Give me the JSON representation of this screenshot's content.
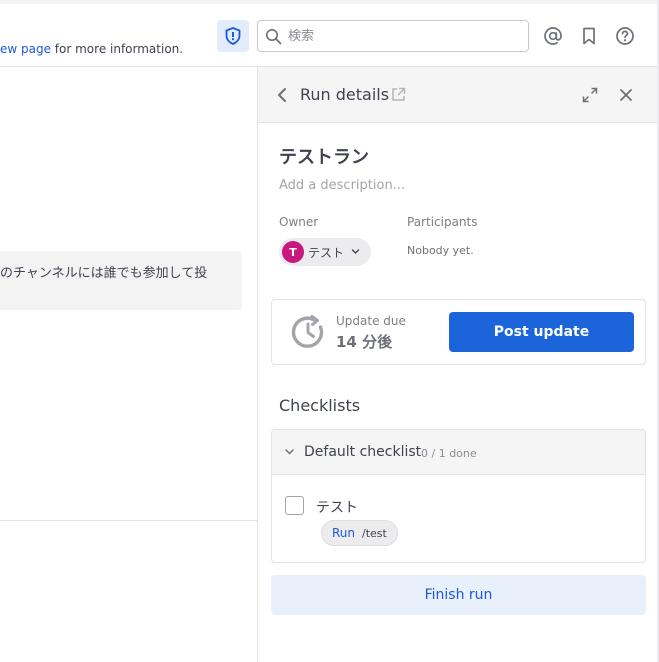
{
  "header": {
    "info_link": "ew page",
    "info_suffix": " for more information.",
    "search_placeholder": "検索",
    "icons": [
      "shield-icon",
      "search-icon",
      "at-mention-icon",
      "bookmark-icon",
      "help-icon"
    ]
  },
  "channel": {
    "message_snippet": "のチャンネルには誰でも参加して投"
  },
  "rhs": {
    "title": "Run details",
    "run_name": "テストラン",
    "description_placeholder": "Add a description...",
    "owner_label": "Owner",
    "owner_initial": "T",
    "owner_name": "テスト",
    "owner_avatar_color": "#c8187f",
    "participants_label": "Participants",
    "participants_value": "Nobody yet.",
    "update_due_label": "Update due",
    "update_due_value": "14 分後",
    "post_update_label": "Post update",
    "checklists_title": "Checklists",
    "checklist": {
      "name": "Default checklist",
      "progress": "0 / 1 done",
      "items": [
        {
          "label": "テスト",
          "checked": false,
          "command_run_label": "Run",
          "command": "/test"
        }
      ]
    },
    "finish_label": "Finish run"
  },
  "colors": {
    "accent": "#1c64d9",
    "link": "#1c58d9",
    "panel_header_bg": "#f5f5f6",
    "finish_bg": "#e8f0fc"
  }
}
